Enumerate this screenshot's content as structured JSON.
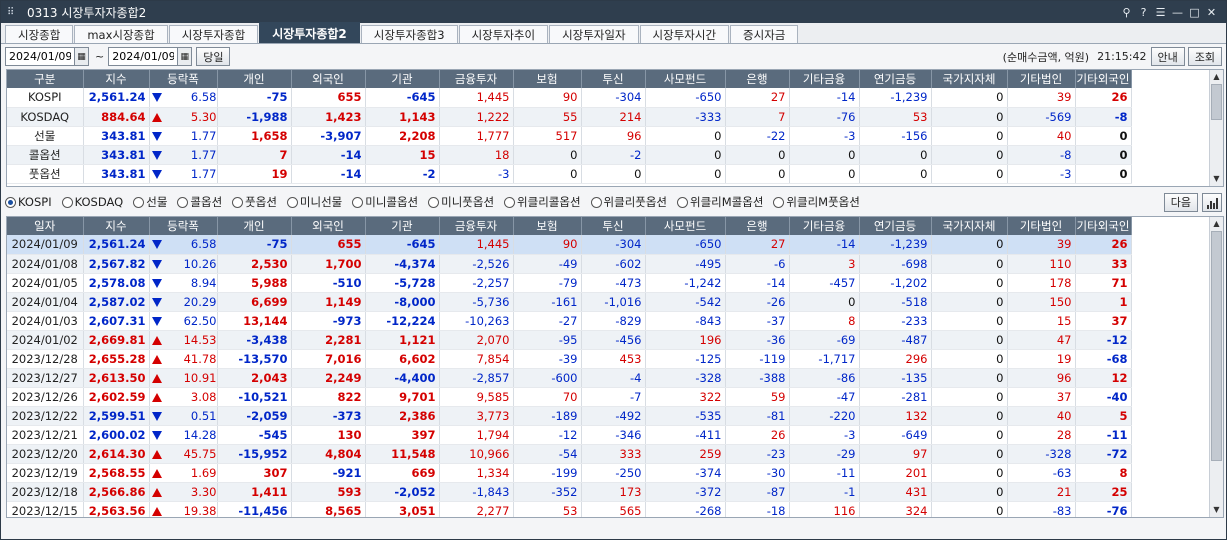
{
  "window": {
    "title": "0313 시장투자자종합2",
    "controls": [
      "⚲",
      "?",
      "☰",
      "—",
      "□",
      "✕"
    ]
  },
  "tabs": [
    "시장종합",
    "max시장종합",
    "시장투자종합",
    "시장투자종합2",
    "시장투자종합3",
    "시장투자추이",
    "시장투자일자",
    "시장투자시간",
    "증시자금"
  ],
  "active_tab": 3,
  "toolbar": {
    "date_from": "2024/01/09",
    "tilde": "~",
    "date_to": "2024/01/09",
    "query_label": "당일",
    "unit": "(순매수금액, 억원)",
    "time": "21:15:42",
    "guide_label": "안내",
    "search_label": "조회"
  },
  "top_headers": [
    "구분",
    "지수",
    "등락폭",
    "개인",
    "외국인",
    "기관",
    "금융투자",
    "보험",
    "투신",
    "사모펀드",
    "은행",
    "기타금융",
    "연기금등",
    "국가지자체",
    "기타법인",
    "기타외국인"
  ],
  "top_rows": [
    {
      "name": "KOSPI",
      "index": "2,561.24",
      "dir": "dn",
      "chg": "6.58",
      "v": [
        "-75",
        "655",
        "-645",
        "1,445",
        "90",
        "-304",
        "-650",
        "27",
        "-14",
        "-1,239",
        "0",
        "39",
        "26"
      ]
    },
    {
      "name": "KOSDAQ",
      "index": "884.64",
      "dir": "up",
      "chg": "5.30",
      "v": [
        "-1,988",
        "1,423",
        "1,143",
        "1,222",
        "55",
        "214",
        "-333",
        "7",
        "-76",
        "53",
        "0",
        "-569",
        "-8"
      ]
    },
    {
      "name": "선물",
      "index": "343.81",
      "dir": "dn",
      "chg": "1.77",
      "v": [
        "1,658",
        "-3,907",
        "2,208",
        "1,777",
        "517",
        "96",
        "0",
        "-22",
        "-3",
        "-156",
        "0",
        "40",
        "0"
      ]
    },
    {
      "name": "콜옵션",
      "index": "343.81",
      "dir": "dn",
      "chg": "1.77",
      "v": [
        "7",
        "-14",
        "15",
        "18",
        "0",
        "-2",
        "0",
        "0",
        "0",
        "0",
        "0",
        "-8",
        "0"
      ]
    },
    {
      "name": "풋옵션",
      "index": "343.81",
      "dir": "dn",
      "chg": "1.77",
      "v": [
        "19",
        "-14",
        "-2",
        "-3",
        "0",
        "0",
        "0",
        "0",
        "0",
        "0",
        "0",
        "-3",
        "0"
      ]
    }
  ],
  "radios": [
    "KOSPI",
    "KOSDAQ",
    "선물",
    "콜옵션",
    "풋옵션",
    "미니선물",
    "미니콜옵션",
    "미니풋옵션",
    "위클리콜옵션",
    "위클리풋옵션",
    "위클리M콜옵션",
    "위클리M풋옵션"
  ],
  "radio_selected": 0,
  "next_label": "다음",
  "bottom_headers": [
    "일자",
    "지수",
    "등락폭",
    "개인",
    "외국인",
    "기관",
    "금융투자",
    "보험",
    "투신",
    "사모펀드",
    "은행",
    "기타금융",
    "연기금등",
    "국가지자체",
    "기타법인",
    "기타외국인"
  ],
  "bottom_rows": [
    {
      "date": "2024/01/09",
      "index": "2,561.24",
      "dir": "dn",
      "chg": "6.58",
      "v": [
        "-75",
        "655",
        "-645",
        "1,445",
        "90",
        "-304",
        "-650",
        "27",
        "-14",
        "-1,239",
        "0",
        "39",
        "26"
      ]
    },
    {
      "date": "2024/01/08",
      "index": "2,567.82",
      "dir": "dn",
      "chg": "10.26",
      "v": [
        "2,530",
        "1,700",
        "-4,374",
        "-2,526",
        "-49",
        "-602",
        "-495",
        "-6",
        "3",
        "-698",
        "0",
        "110",
        "33"
      ]
    },
    {
      "date": "2024/01/05",
      "index": "2,578.08",
      "dir": "dn",
      "chg": "8.94",
      "v": [
        "5,988",
        "-510",
        "-5,728",
        "-2,257",
        "-79",
        "-473",
        "-1,242",
        "-14",
        "-457",
        "-1,202",
        "0",
        "178",
        "71"
      ]
    },
    {
      "date": "2024/01/04",
      "index": "2,587.02",
      "dir": "dn",
      "chg": "20.29",
      "v": [
        "6,699",
        "1,149",
        "-8,000",
        "-5,736",
        "-161",
        "-1,016",
        "-542",
        "-26",
        "0",
        "-518",
        "0",
        "150",
        "1"
      ]
    },
    {
      "date": "2024/01/03",
      "index": "2,607.31",
      "dir": "dn",
      "chg": "62.50",
      "v": [
        "13,144",
        "-973",
        "-12,224",
        "-10,263",
        "-27",
        "-829",
        "-843",
        "-37",
        "8",
        "-233",
        "0",
        "15",
        "37"
      ]
    },
    {
      "date": "2024/01/02",
      "index": "2,669.81",
      "dir": "up",
      "chg": "14.53",
      "v": [
        "-3,438",
        "2,281",
        "1,121",
        "2,070",
        "-95",
        "-456",
        "196",
        "-36",
        "-69",
        "-487",
        "0",
        "47",
        "-12"
      ]
    },
    {
      "date": "2023/12/28",
      "index": "2,655.28",
      "dir": "up",
      "chg": "41.78",
      "v": [
        "-13,570",
        "7,016",
        "6,602",
        "7,854",
        "-39",
        "453",
        "-125",
        "-119",
        "-1,717",
        "296",
        "0",
        "19",
        "-68"
      ]
    },
    {
      "date": "2023/12/27",
      "index": "2,613.50",
      "dir": "up",
      "chg": "10.91",
      "v": [
        "2,043",
        "2,249",
        "-4,400",
        "-2,857",
        "-600",
        "-4",
        "-328",
        "-388",
        "-86",
        "-135",
        "0",
        "96",
        "12"
      ]
    },
    {
      "date": "2023/12/26",
      "index": "2,602.59",
      "dir": "up",
      "chg": "3.08",
      "v": [
        "-10,521",
        "822",
        "9,701",
        "9,585",
        "70",
        "-7",
        "322",
        "59",
        "-47",
        "-281",
        "0",
        "37",
        "-40"
      ]
    },
    {
      "date": "2023/12/22",
      "index": "2,599.51",
      "dir": "dn",
      "chg": "0.51",
      "v": [
        "-2,059",
        "-373",
        "2,386",
        "3,773",
        "-189",
        "-492",
        "-535",
        "-81",
        "-220",
        "132",
        "0",
        "40",
        "5"
      ]
    },
    {
      "date": "2023/12/21",
      "index": "2,600.02",
      "dir": "dn",
      "chg": "14.28",
      "v": [
        "-545",
        "130",
        "397",
        "1,794",
        "-12",
        "-346",
        "-411",
        "26",
        "-3",
        "-649",
        "0",
        "28",
        "-11"
      ]
    },
    {
      "date": "2023/12/20",
      "index": "2,614.30",
      "dir": "up",
      "chg": "45.75",
      "v": [
        "-15,952",
        "4,804",
        "11,548",
        "10,966",
        "-54",
        "333",
        "259",
        "-23",
        "-29",
        "97",
        "0",
        "-328",
        "-72"
      ]
    },
    {
      "date": "2023/12/19",
      "index": "2,568.55",
      "dir": "up",
      "chg": "1.69",
      "v": [
        "307",
        "-921",
        "669",
        "1,334",
        "-199",
        "-250",
        "-374",
        "-30",
        "-11",
        "201",
        "0",
        "-63",
        "8"
      ]
    },
    {
      "date": "2023/12/18",
      "index": "2,566.86",
      "dir": "up",
      "chg": "3.30",
      "v": [
        "1,411",
        "593",
        "-2,052",
        "-1,843",
        "-352",
        "173",
        "-372",
        "-87",
        "-1",
        "431",
        "0",
        "21",
        "25"
      ]
    },
    {
      "date": "2023/12/15",
      "index": "2,563.56",
      "dir": "up",
      "chg": "19.38",
      "v": [
        "-11,456",
        "8,565",
        "3,051",
        "2,277",
        "53",
        "565",
        "-268",
        "-18",
        "116",
        "324",
        "0",
        "-83",
        "-76"
      ]
    }
  ]
}
